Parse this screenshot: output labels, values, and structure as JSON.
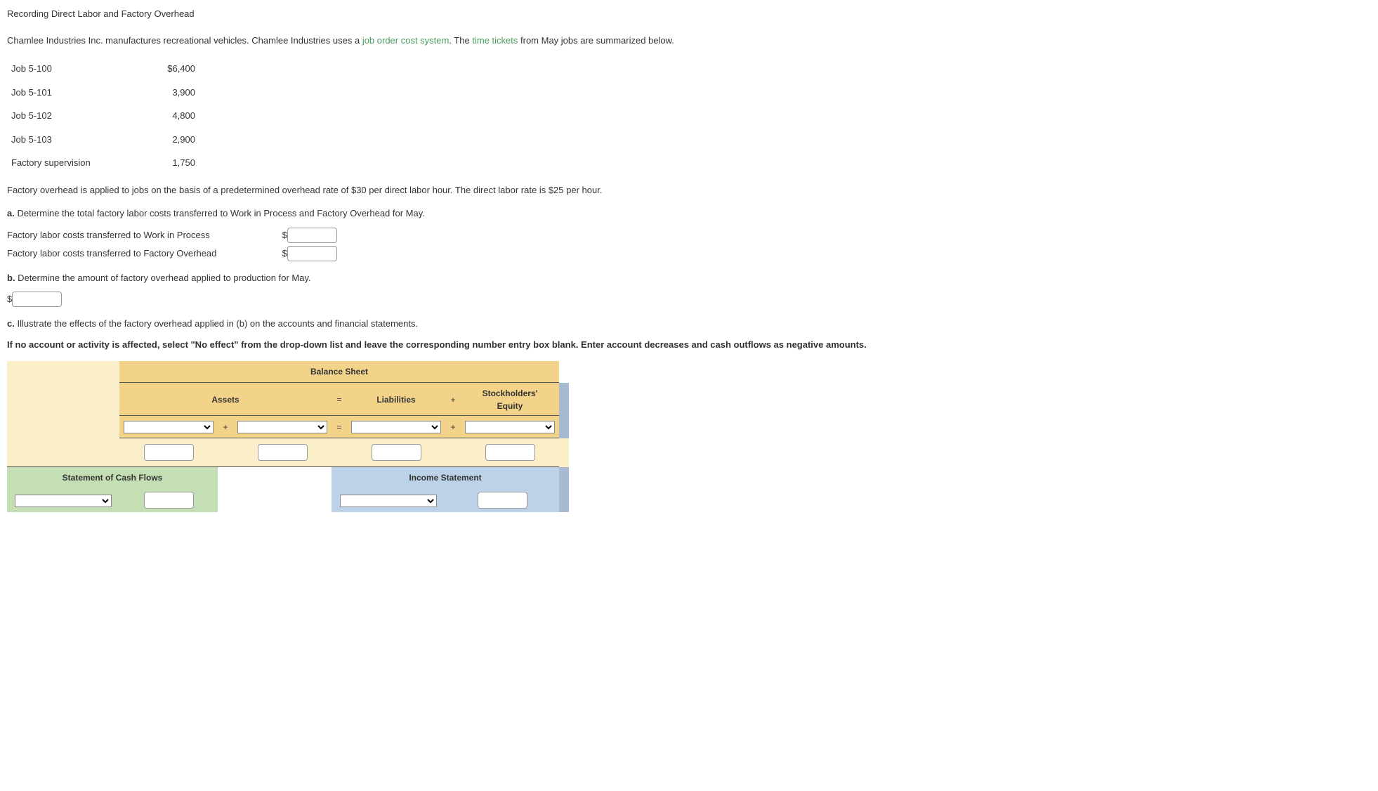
{
  "title": "Recording Direct Labor and Factory Overhead",
  "intro_1": "Chamlee Industries Inc. manufactures recreational vehicles. Chamlee Industries uses a ",
  "term1": "job order cost system",
  "intro_2": ". The ",
  "term2": "time tickets",
  "intro_3": " from May jobs are summarized below.",
  "jobs": [
    {
      "name": "Job 5-100",
      "amount": "$6,400"
    },
    {
      "name": "Job 5-101",
      "amount": "3,900"
    },
    {
      "name": "Job 5-102",
      "amount": "4,800"
    },
    {
      "name": "Job 5-103",
      "amount": "2,900"
    },
    {
      "name": "Factory supervision",
      "amount": "1,750"
    }
  ],
  "rate_para": "Factory overhead is applied to jobs on the basis of a predetermined overhead rate of $30 per direct labor hour. The direct labor rate is $25 per hour.",
  "qa": {
    "label": "a.",
    "text": "  Determine the total factory labor costs transferred to Work in Process and Factory Overhead for May.",
    "row1": "Factory labor costs transferred to Work in Process",
    "row2": "Factory labor costs transferred to Factory Overhead"
  },
  "qb": {
    "label": "b.",
    "text": "  Determine the amount of factory overhead applied to production for May."
  },
  "qc": {
    "label": "c.",
    "text": "  Illustrate the effects of the factory overhead applied in (b) on the accounts and financial statements."
  },
  "instruct": "If no account or activity is affected, select \"No effect\" from the drop-down list and leave the corresponding number entry box blank. Enter account decreases and cash outflows as negative amounts.",
  "fx": {
    "balance_sheet": "Balance Sheet",
    "assets": "Assets",
    "eq": "=",
    "liabilities": "Liabilities",
    "plus": "+",
    "se1": "Stockholders'",
    "se2": "Equity",
    "scf": "Statement of Cash Flows",
    "is": "Income Statement"
  },
  "dollar": "$"
}
